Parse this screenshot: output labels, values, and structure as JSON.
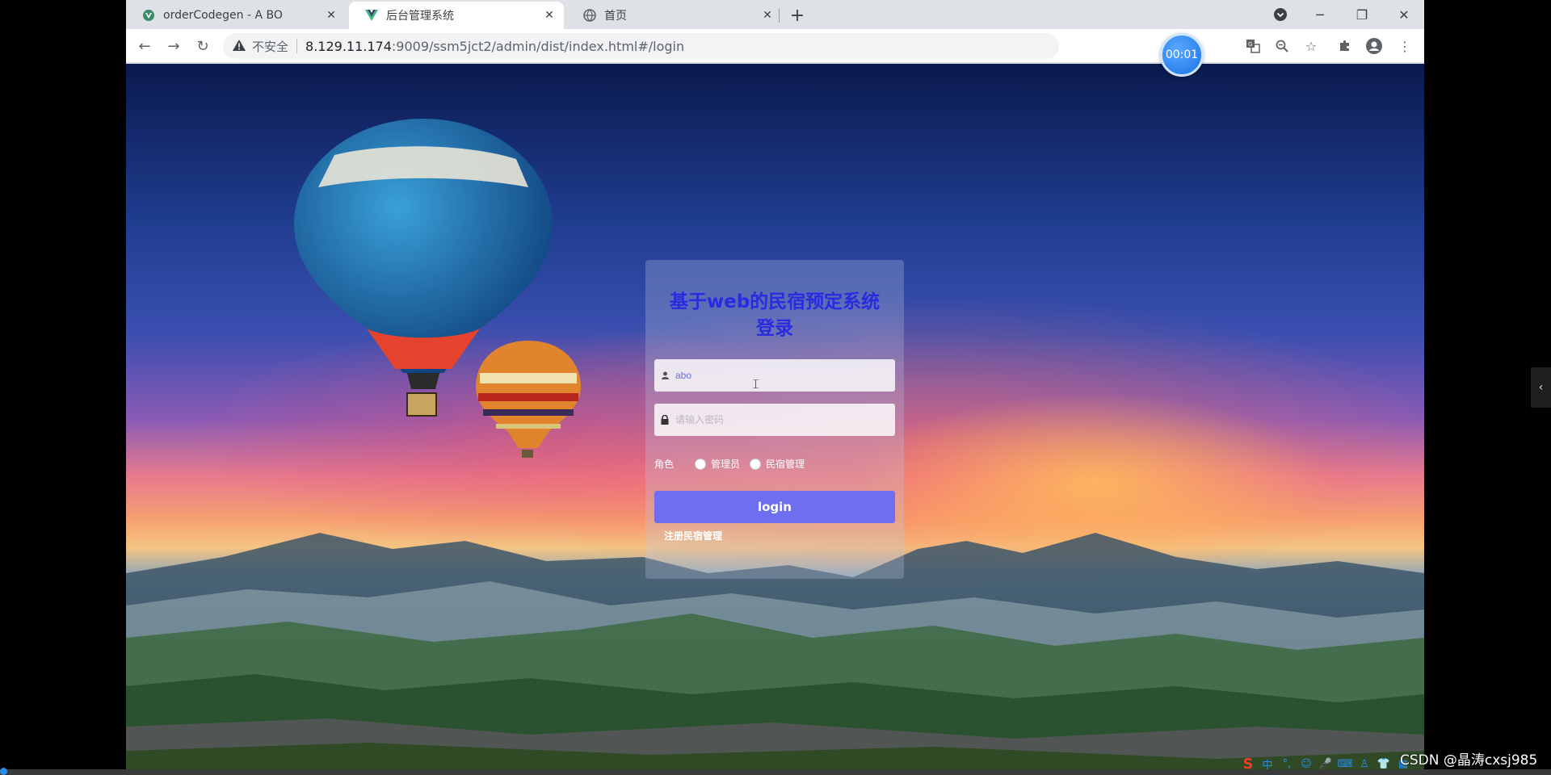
{
  "tabs": [
    {
      "title": "orderCodegen - A BO",
      "favicon": "vue-logo-icon"
    },
    {
      "title": "后台管理系统",
      "favicon": "vue-logo-icon"
    },
    {
      "title": "首页",
      "favicon": "globe-icon"
    }
  ],
  "address_bar": {
    "security_label": "不安全",
    "host": "8.129.11.174",
    "path": ":9009/ssm5jct2/admin/dist/index.html#/login"
  },
  "recording_timer": "00:01",
  "login": {
    "title_line1": "基于web的民宿预定系统",
    "title_line2": "登录",
    "username_value": "abo",
    "password_placeholder": "请输入密码",
    "role_label": "角色",
    "role_options": [
      "管理员",
      "民宿管理"
    ],
    "login_button": "login",
    "register_link": "注册民宿管理"
  },
  "watermark": "CSDN @晶涛cxsj985",
  "colors": {
    "title": "#2a2ae0",
    "login_button": "#6f6ef0",
    "username_text": "#6e6edb"
  }
}
